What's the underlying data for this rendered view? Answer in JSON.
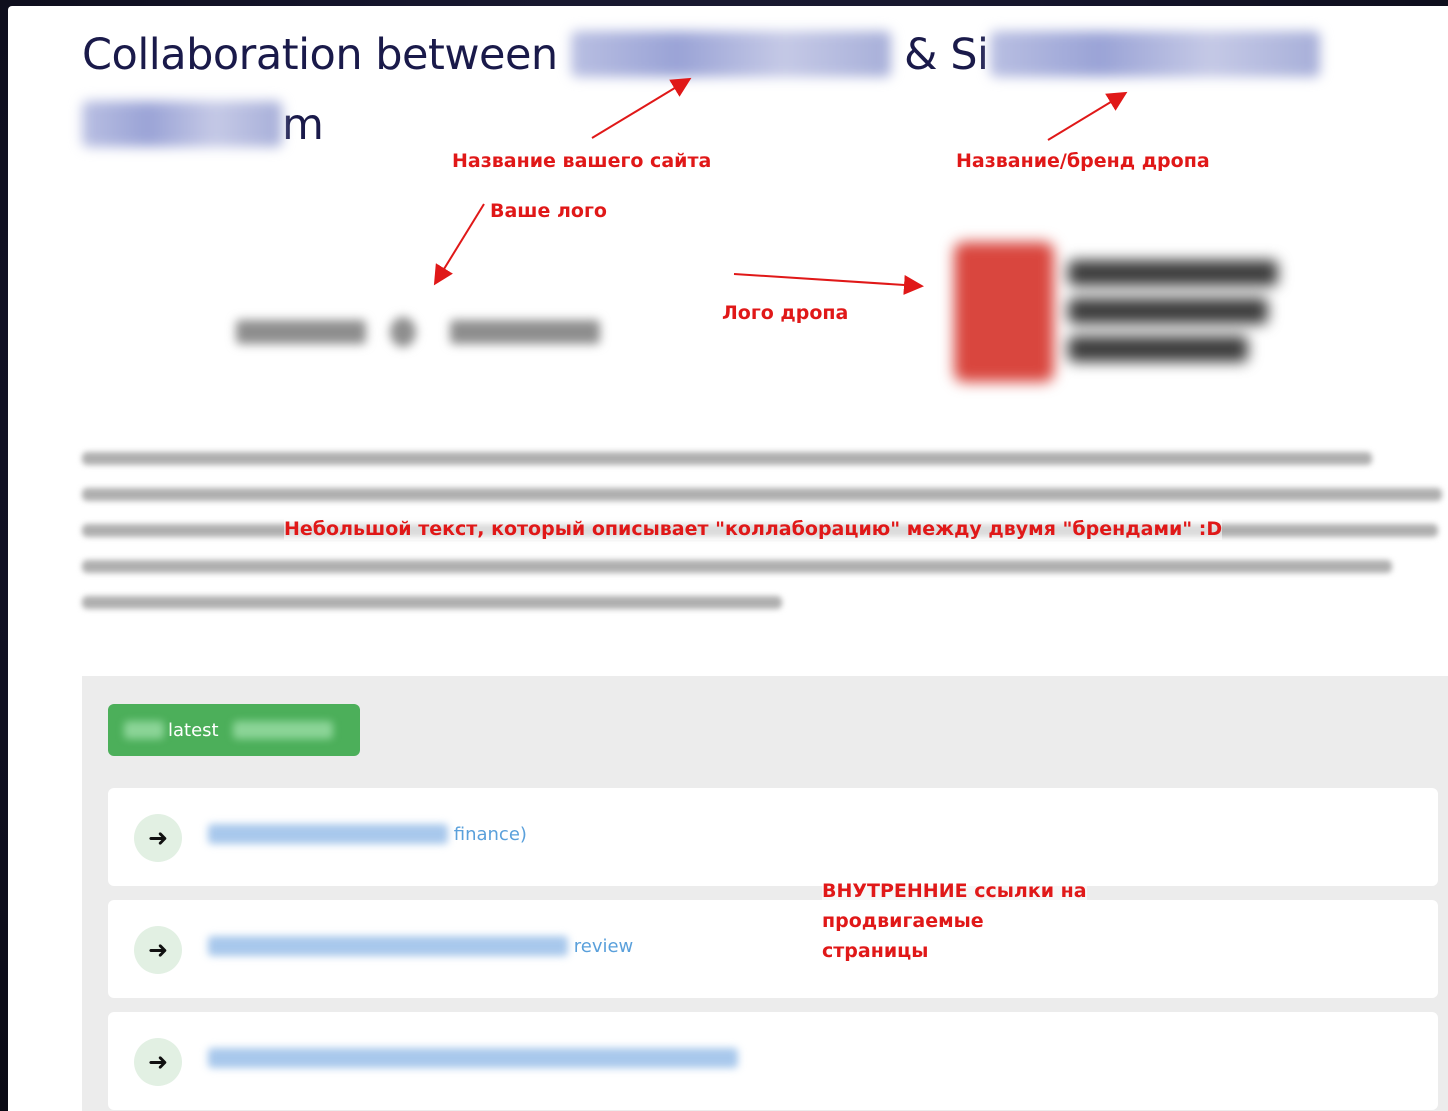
{
  "page": {
    "title_prefix": "Collaboration between",
    "title_amp": "& Si",
    "title_tail": "m"
  },
  "annotations": {
    "site_name": "Название вашего сайта",
    "drop_brand": "Название/бренд дропа",
    "your_logo": "Ваше лого",
    "drop_logo": "Лого дропа",
    "description": "Небольшой текст, который описывает \"коллаборацию\" между двумя \"брендами\" :D",
    "internal_links_line1": "ВНУТРЕННИЕ ссылки на",
    "internal_links_line2": "продвигаемые",
    "internal_links_line3": "страницы"
  },
  "latest": {
    "label": "latest"
  },
  "links": [
    {
      "visible_text": "finance)"
    },
    {
      "visible_text": "review"
    },
    {
      "visible_text": ""
    }
  ],
  "colors": {
    "title": "#1a1a4a",
    "annotation": "#e01818",
    "button": "#4caf5a",
    "link": "#5aa0db",
    "panel": "#ececec"
  },
  "icons": {
    "row_arrow": "arrow-right-icon"
  }
}
